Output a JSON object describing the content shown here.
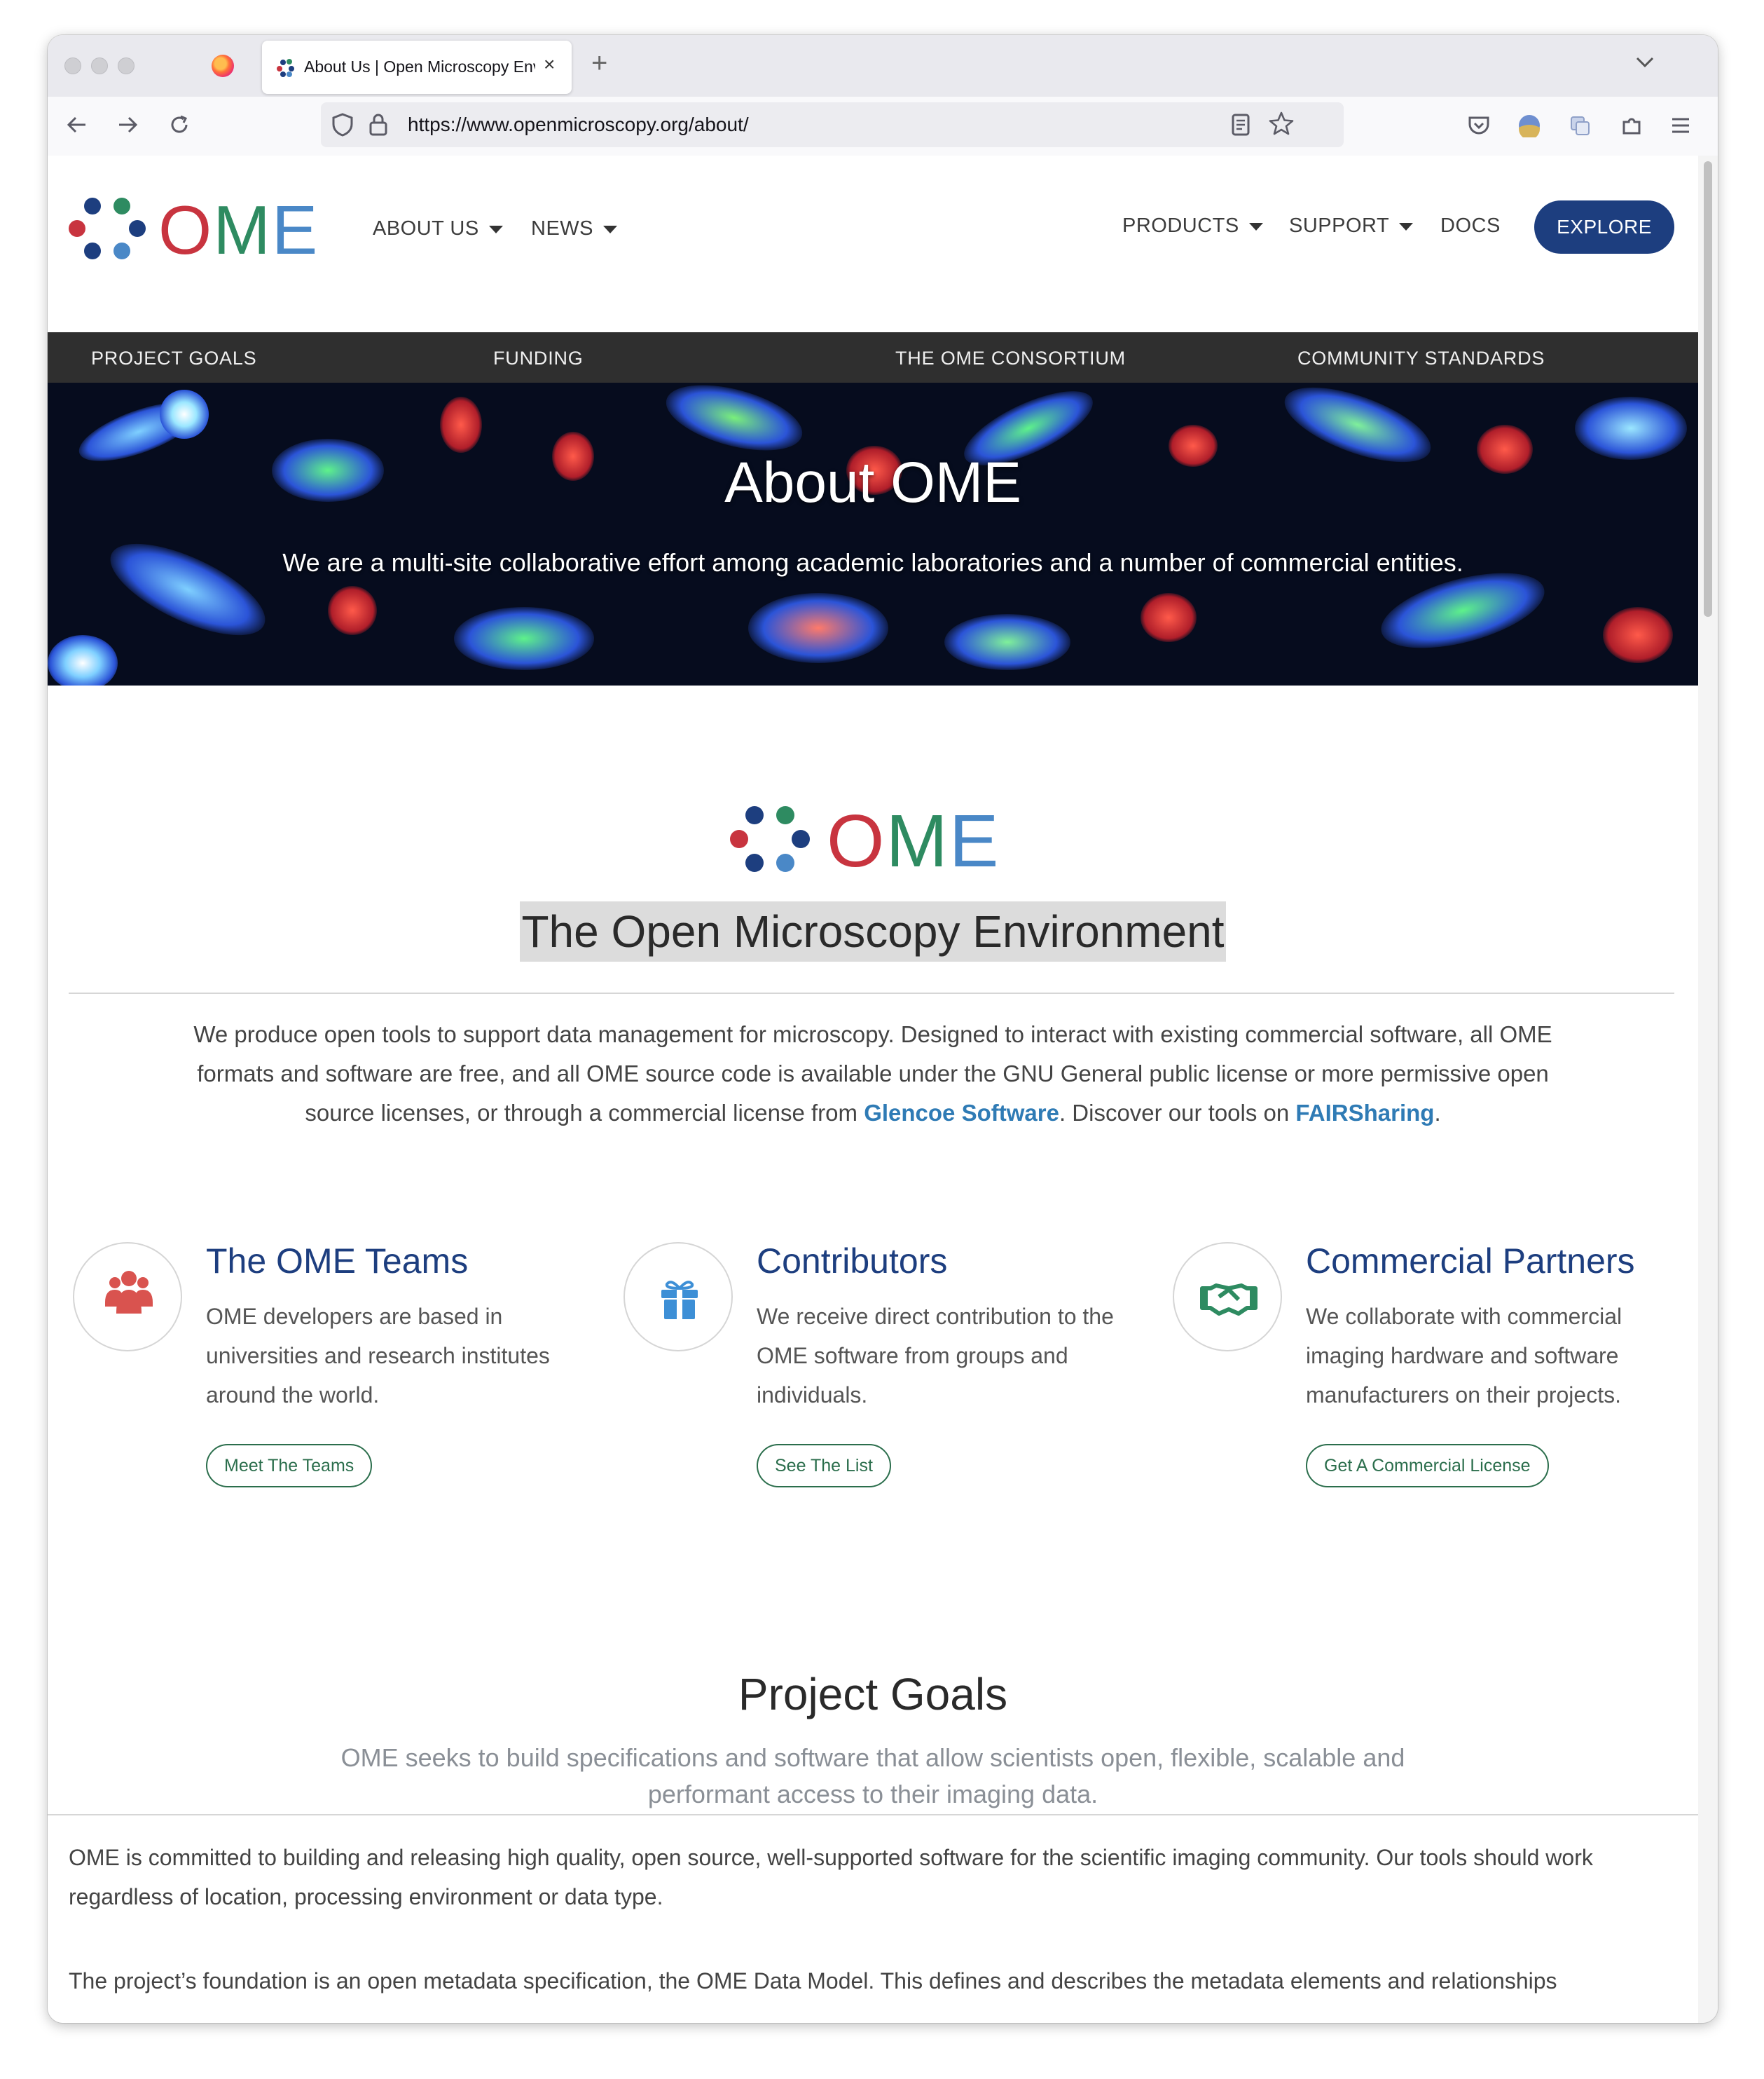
{
  "browser": {
    "tab_title": "About Us | Open Microscopy Environment",
    "tab_close": "×",
    "new_tab": "+",
    "url": "https://www.openmicroscopy.org/about/"
  },
  "header": {
    "logo_text": "OME",
    "nav_left": [
      {
        "label": "ABOUT US"
      },
      {
        "label": "NEWS"
      }
    ],
    "nav_right": [
      {
        "label": "PRODUCTS"
      },
      {
        "label": "SUPPORT"
      },
      {
        "label": "DOCS"
      }
    ],
    "explore_label": "EXPLORE"
  },
  "subnav": [
    "PROJECT GOALS",
    "FUNDING",
    "THE OME CONSORTIUM",
    "COMMUNITY STANDARDS"
  ],
  "hero": {
    "title": "About OME",
    "subtitle": "We are a multi-site collaborative effort among academic laboratories and a number of commercial entities."
  },
  "main": {
    "logo_text": "OME",
    "title": "The Open Microscopy Environment",
    "intro_1": "We produce open tools to support data management for microscopy. Designed to interact with existing commercial software, all OME formats and software are free, and all OME source code is available under the GNU General public license or more permissive open source licenses, or through a commercial license from ",
    "intro_link_1": "Glencoe Software",
    "intro_2": ". Discover our tools on ",
    "intro_link_2": "FAIRSharing",
    "intro_3": "."
  },
  "features": [
    {
      "icon": "users-icon",
      "title": "The OME Teams",
      "text": "OME developers are based in universities and research institutes around the world.",
      "button": "Meet The Teams"
    },
    {
      "icon": "gift-icon",
      "title": "Contributors",
      "text": "We receive direct contribution to the OME software from groups and individuals.",
      "button": "See The List"
    },
    {
      "icon": "handshake-icon",
      "title": "Commercial Partners",
      "text": "We collaborate with commercial imaging hardware and software manufacturers on their projects.",
      "button": "Get A Commercial License"
    }
  ],
  "goals": {
    "title": "Project Goals",
    "subtitle": "OME seeks to build specifications and software that allow scientists open, flexible, scalable and performant access to their imaging data.",
    "para_1": "OME is committed to building and releasing high quality, open source, well-supported software for the scientific imaging community. Our tools should work regardless of location, processing environment or data type.",
    "para_2": "The project’s foundation is an open metadata specification, the OME Data Model. This defines and describes the metadata elements and relationships"
  },
  "colors": {
    "brand_red": "#c8343f",
    "brand_green": "#2e8b61",
    "brand_blue": "#4a88c7",
    "brand_navy": "#1d3e7f",
    "link_blue": "#2f7bb5"
  }
}
